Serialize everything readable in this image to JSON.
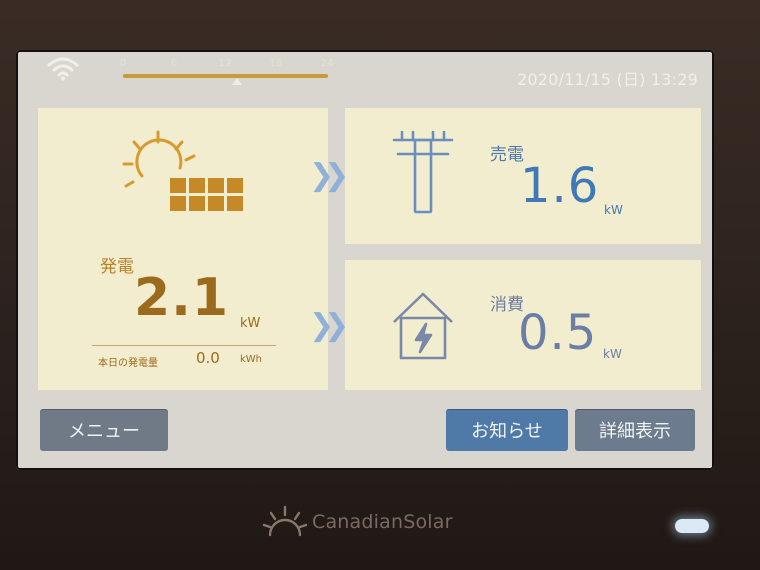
{
  "header": {
    "timeline_ticks": [
      "0",
      "6",
      "12",
      "18",
      "24"
    ],
    "current_time_fraction": 0.56,
    "datetime": "2020/11/15 (日) 13:29"
  },
  "generation": {
    "label": "発電",
    "value": "2.1",
    "unit": "kW",
    "today_label": "本日の発電量",
    "today_value": "0.0",
    "today_unit": "kWh"
  },
  "sell": {
    "label": "売電",
    "value": "1.6",
    "unit": "kW"
  },
  "consumption": {
    "label": "消費",
    "value": "0.5",
    "unit": "kW"
  },
  "buttons": {
    "menu": "メニュー",
    "news": "お知らせ",
    "detail": "詳細表示"
  },
  "brand": {
    "name": "CanadianSolar"
  },
  "colors": {
    "generation": "#9b6a1c",
    "sell": "#3f79b8",
    "consumption": "#6a7ea6",
    "panel_bg": "#f3edcf"
  }
}
